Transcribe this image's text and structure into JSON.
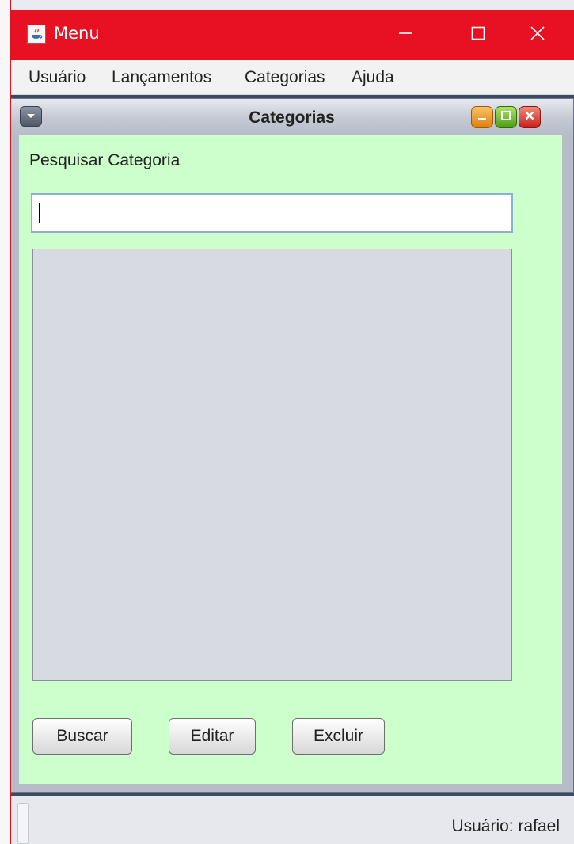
{
  "window": {
    "title": "Menu",
    "accent_color": "#e81123"
  },
  "menubar": {
    "items": [
      "Usuário",
      "Lançamentos",
      "Categorias",
      "Ajuda"
    ]
  },
  "internal_frame": {
    "title": "Categorias",
    "background_color": "#ccffcc",
    "search_label": "Pesquisar Categoria",
    "search_value": "",
    "buttons": {
      "buscar": "Buscar",
      "editar": "Editar",
      "excluir": "Excluir"
    }
  },
  "statusbar": {
    "text": "Usuário: rafael"
  },
  "icons": {
    "app": "java-icon",
    "minimize": "minimize-icon",
    "maximize": "maximize-icon",
    "close": "close-icon",
    "system_menu": "chevron-down-icon"
  }
}
